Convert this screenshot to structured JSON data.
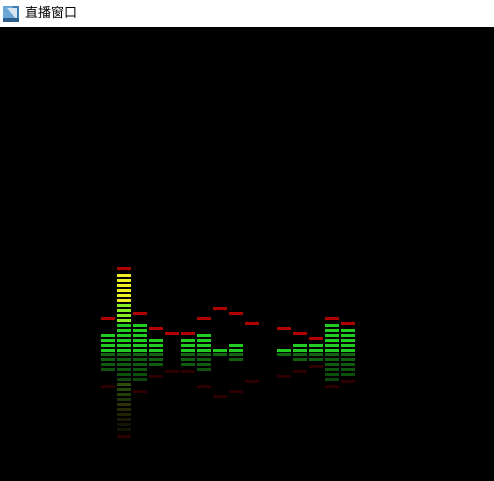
{
  "window": {
    "title": "直播窗口",
    "icon": "app-window-icon",
    "background_color": "#000000",
    "titlebar_color": "#ffffff"
  },
  "visualizer": {
    "description_type": "spectrum-analyzer",
    "segment_colors": {
      "low": "#22cc22",
      "mid": "#88ee22",
      "high": "#eeee22",
      "peak": "#b00000"
    },
    "max_level": 16,
    "bands": [
      {
        "level": 4,
        "peak": 7
      },
      {
        "level": 16,
        "peak": 17
      },
      {
        "level": 6,
        "peak": 8
      },
      {
        "level": 3,
        "peak": 5
      },
      {
        "level": 0,
        "peak": 4
      },
      {
        "level": 3,
        "peak": 4
      },
      {
        "level": 4,
        "peak": 7
      },
      {
        "level": 1,
        "peak": 9
      },
      {
        "level": 2,
        "peak": 8
      },
      {
        "level": 0,
        "peak": 6
      },
      {
        "level": 0,
        "peak": 0
      },
      {
        "level": 1,
        "peak": 5
      },
      {
        "level": 2,
        "peak": 4
      },
      {
        "level": 2,
        "peak": 3
      },
      {
        "level": 6,
        "peak": 7
      },
      {
        "level": 5,
        "peak": 6
      }
    ]
  }
}
